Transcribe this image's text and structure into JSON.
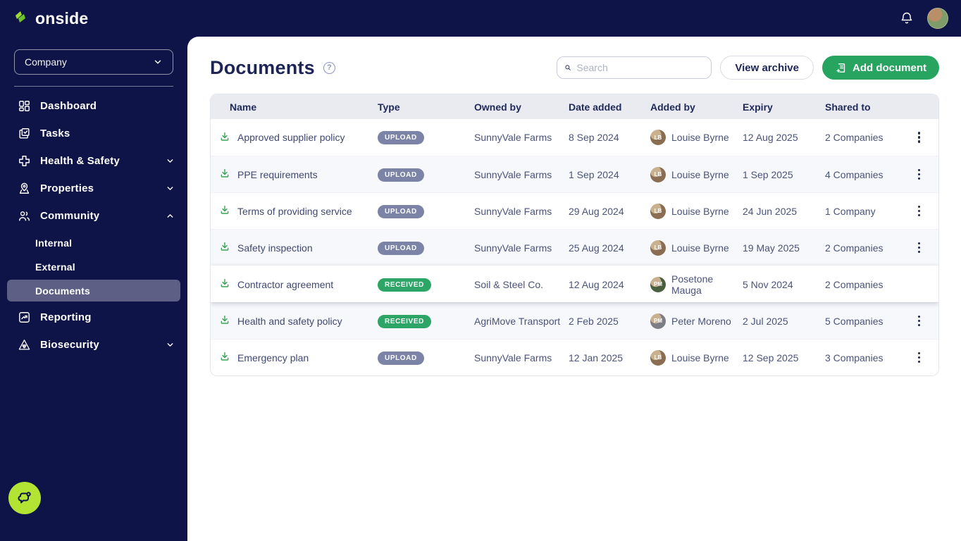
{
  "brand": {
    "name": "onside"
  },
  "topbar": {
    "icons": [
      "notification-bell",
      "user-avatar"
    ]
  },
  "sidebar": {
    "company_selector": {
      "label": "Company"
    },
    "items": [
      {
        "label": "Dashboard",
        "icon": "dashboard-grid"
      },
      {
        "label": "Tasks",
        "icon": "tasks"
      },
      {
        "label": "Health & Safety",
        "icon": "medical-cross",
        "chevron": "down"
      },
      {
        "label": "Properties",
        "icon": "map-pin",
        "chevron": "down"
      },
      {
        "label": "Community",
        "icon": "people",
        "chevron": "up"
      },
      {
        "label": "Reporting",
        "icon": "chart"
      },
      {
        "label": "Biosecurity",
        "icon": "biohazard-triangle",
        "chevron": "down"
      }
    ],
    "community_children": [
      {
        "label": "Internal",
        "active": false
      },
      {
        "label": "External",
        "active": false
      },
      {
        "label": "Documents",
        "active": true
      }
    ]
  },
  "header": {
    "title": "Documents",
    "help_icon": "?",
    "search_placeholder": "Search",
    "view_archive_label": "View archive",
    "add_document_label": "Add document"
  },
  "table": {
    "columns": [
      "Name",
      "Type",
      "Owned by",
      "Date added",
      "Added by",
      "Expiry",
      "Shared to",
      ""
    ],
    "rows": [
      {
        "name": "Approved supplier policy",
        "type": "UPLOAD",
        "owned_by": "SunnyVale Farms",
        "date_added": "8 Sep 2024",
        "added_by": "Louise Byrne",
        "expiry": "12 Aug 2025",
        "shared_to": "2 Companies",
        "avatar_color": "#8a6d52",
        "striped": false,
        "elevated": false
      },
      {
        "name": "PPE requirements",
        "type": "UPLOAD",
        "owned_by": "SunnyVale Farms",
        "date_added": "1 Sep 2024",
        "added_by": "Louise Byrne",
        "expiry": "1 Sep 2025",
        "shared_to": "4 Companies",
        "avatar_color": "#8a6d52",
        "striped": true,
        "elevated": false
      },
      {
        "name": "Terms of providing service",
        "type": "UPLOAD",
        "owned_by": "SunnyVale Farms",
        "date_added": "29 Aug 2024",
        "added_by": "Louise Byrne",
        "expiry": "24 Jun 2025",
        "shared_to": "1 Company",
        "avatar_color": "#8a6d52",
        "striped": false,
        "elevated": false
      },
      {
        "name": "Safety inspection",
        "type": "UPLOAD",
        "owned_by": "SunnyVale Farms",
        "date_added": "25 Aug 2024",
        "added_by": "Louise Byrne",
        "expiry": "19 May 2025",
        "shared_to": "2 Companies",
        "avatar_color": "#8a6d52",
        "striped": true,
        "elevated": false
      },
      {
        "name": "Contractor agreement",
        "type": "RECEIVED",
        "owned_by": "Soil & Steel Co.",
        "date_added": "12 Aug 2024",
        "added_by": "Posetone Mauga",
        "expiry": "5 Nov 2024",
        "shared_to": "2 Companies",
        "avatar_color": "#49603e",
        "striped": false,
        "elevated": true
      },
      {
        "name": "Health and safety policy",
        "type": "RECEIVED",
        "owned_by": "AgriMove Transport",
        "date_added": "2 Feb 2025",
        "added_by": "Peter Moreno",
        "expiry": "2 Jul 2025",
        "shared_to": "5 Companies",
        "avatar_color": "#7d7d85",
        "striped": true,
        "elevated": false
      },
      {
        "name": "Emergency plan",
        "type": "UPLOAD",
        "owned_by": "SunnyVale Farms",
        "date_added": "12 Jan 2025",
        "added_by": "Louise Byrne",
        "expiry": "12 Sep 2025",
        "shared_to": "3 Companies",
        "avatar_color": "#8a6d52",
        "striped": false,
        "elevated": false
      }
    ]
  },
  "colors": {
    "navy": "#0e1348",
    "accent-green": "#27a45f",
    "lime": "#b3e434",
    "badge-upload": "#7b84a6",
    "badge-received": "#2ca566"
  }
}
